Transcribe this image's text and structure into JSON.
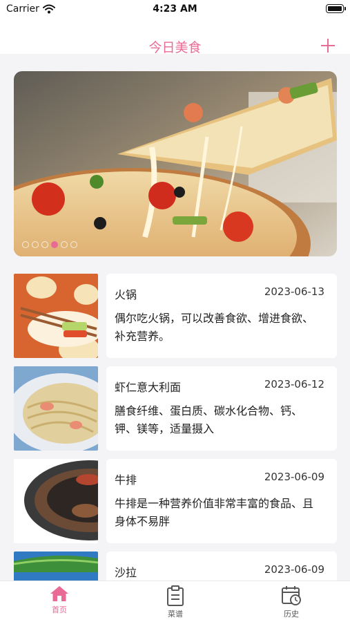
{
  "status_bar": {
    "carrier": "Carrier",
    "time": "4:23 AM"
  },
  "nav": {
    "title": "今日美食",
    "add_icon": "plus-icon"
  },
  "banner": {
    "image": "pizza-photo",
    "dots": 6,
    "active_dot": 3
  },
  "items": [
    {
      "title": "火锅",
      "date": "2023-06-13",
      "desc": "偶尔吃火锅，可以改善食欲、增进食欲、补充营养。",
      "thumb": "hotpot-cartoon"
    },
    {
      "title": "虾仁意大利面",
      "date": "2023-06-12",
      "desc": "膳食纤维、蛋白质、碳水化合物、钙、钾、镁等，适量摄入",
      "thumb": "pasta-photo"
    },
    {
      "title": "牛排",
      "date": "2023-06-09",
      "desc": "牛排是一种营养价值非常丰富的食品、且身体不易胖",
      "thumb": "steak-photo"
    },
    {
      "title": "沙拉",
      "date": "2023-06-09",
      "desc": "",
      "thumb": "salad-photo"
    }
  ],
  "tabs": [
    {
      "label": "首页",
      "icon": "home-icon",
      "active": true
    },
    {
      "label": "菜谱",
      "icon": "clipboard-icon",
      "active": false
    },
    {
      "label": "历史",
      "icon": "calendar-clock-icon",
      "active": false
    }
  ],
  "colors": {
    "accent": "#ea6a96",
    "background": "#f4f4f6"
  }
}
